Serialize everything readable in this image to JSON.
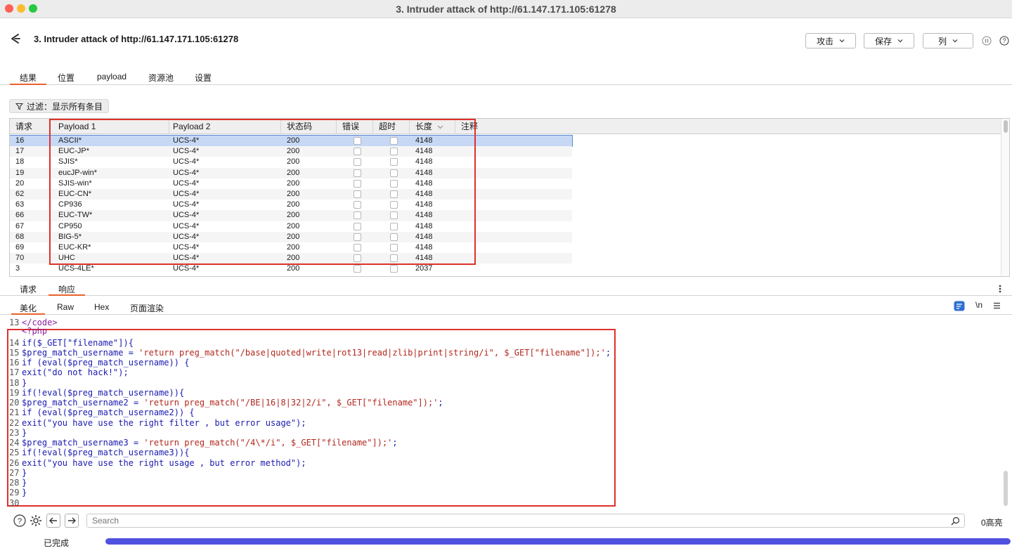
{
  "window": {
    "title": "3. Intruder attack of http://61.147.171.105:61278"
  },
  "header": {
    "title": "3. Intruder attack of http://61.147.171.105:61278",
    "buttons": {
      "attack": "攻击",
      "save": "保存",
      "columns": "列"
    }
  },
  "main_tabs": [
    "结果",
    "位置",
    "payload",
    "资源池",
    "设置"
  ],
  "filter": {
    "label": "过滤：显示所有条目"
  },
  "table": {
    "columns": [
      "请求",
      "Payload 1",
      "Payload 2",
      "状态码",
      "错误",
      "超时",
      "长度",
      "注释"
    ],
    "rows": [
      {
        "req": "16",
        "p1": "ASCII*",
        "p2": "UCS-4*",
        "status": "200",
        "len": "4148"
      },
      {
        "req": "17",
        "p1": "EUC-JP*",
        "p2": "UCS-4*",
        "status": "200",
        "len": "4148"
      },
      {
        "req": "18",
        "p1": "SJIS*",
        "p2": "UCS-4*",
        "status": "200",
        "len": "4148"
      },
      {
        "req": "19",
        "p1": "eucJP-win*",
        "p2": "UCS-4*",
        "status": "200",
        "len": "4148"
      },
      {
        "req": "20",
        "p1": "SJIS-win*",
        "p2": "UCS-4*",
        "status": "200",
        "len": "4148"
      },
      {
        "req": "62",
        "p1": "EUC-CN*",
        "p2": "UCS-4*",
        "status": "200",
        "len": "4148"
      },
      {
        "req": "63",
        "p1": "CP936",
        "p2": "UCS-4*",
        "status": "200",
        "len": "4148"
      },
      {
        "req": "66",
        "p1": "EUC-TW*",
        "p2": "UCS-4*",
        "status": "200",
        "len": "4148"
      },
      {
        "req": "67",
        "p1": "CP950",
        "p2": "UCS-4*",
        "status": "200",
        "len": "4148"
      },
      {
        "req": "68",
        "p1": "BIG-5*",
        "p2": "UCS-4*",
        "status": "200",
        "len": "4148"
      },
      {
        "req": "69",
        "p1": "EUC-KR*",
        "p2": "UCS-4*",
        "status": "200",
        "len": "4148"
      },
      {
        "req": "70",
        "p1": "UHC",
        "p2": "UCS-4*",
        "status": "200",
        "len": "4148"
      },
      {
        "req": "3",
        "p1": "UCS-4LE*",
        "p2": "UCS-4*",
        "status": "200",
        "len": "2037"
      }
    ]
  },
  "reqresp_tabs": [
    "请求",
    "响应"
  ],
  "view_tabs": [
    "美化",
    "Raw",
    "Hex",
    "页面渲染"
  ],
  "view_icons": {
    "newline": "\\n"
  },
  "code": [
    {
      "n": "13",
      "t": "</code>"
    },
    {
      "n": "",
      "t": "<?php"
    },
    {
      "n": "14",
      "t": "if($_GET[\"filename\"]){"
    },
    {
      "n": "15",
      "t": "$preg_match_username = 'return preg_match(\"/base|quoted|write|rot13|read|zlib|print|string/i\", $_GET[\"filename\"]);';"
    },
    {
      "n": "16",
      "t": "if (eval($preg_match_username)) {"
    },
    {
      "n": "17",
      "t": "exit(\"do not hack!\");"
    },
    {
      "n": "18",
      "t": "}"
    },
    {
      "n": "19",
      "t": "if(!eval($preg_match_username)){"
    },
    {
      "n": "20",
      "t": "$preg_match_username2 = 'return preg_match(\"/BE|16|8|32|2/i\", $_GET[\"filename\"]);';"
    },
    {
      "n": "21",
      "t": "if (eval($preg_match_username2)) {"
    },
    {
      "n": "22",
      "t": "exit(\"you have use the right filter , but error usage\");"
    },
    {
      "n": "23",
      "t": "}"
    },
    {
      "n": "24",
      "t": "$preg_match_username3 = 'return preg_match(\"/4\\*/i\", $_GET[\"filename\"]);';"
    },
    {
      "n": "25",
      "t": "if(!eval($preg_match_username3)){"
    },
    {
      "n": "26",
      "t": "exit(\"you have use the right usage , but error method\");"
    },
    {
      "n": "27",
      "t": "}"
    },
    {
      "n": "28",
      "t": "}"
    },
    {
      "n": "29",
      "t": "}"
    },
    {
      "n": "30",
      "t": ""
    }
  ],
  "search": {
    "placeholder": "Search",
    "highlights": "0高亮"
  },
  "status": {
    "text": "已完成",
    "progress": 1.0
  },
  "colors": {
    "accent": "#e8622c",
    "selection": "#c6d8f4",
    "progress": "#5151e0",
    "annotation": "#e0302a"
  }
}
